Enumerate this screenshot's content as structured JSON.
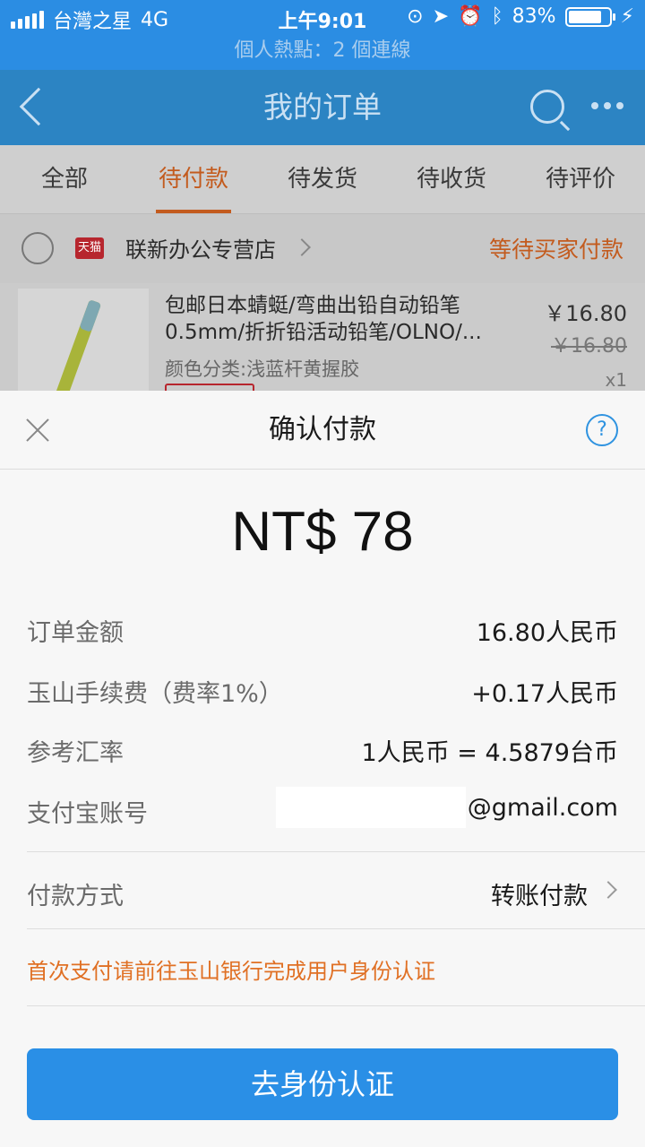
{
  "status_bar": {
    "carrier": "台灣之星",
    "network": "4G",
    "time": "上午9:01",
    "battery": "83%",
    "battery_level": 0.83
  },
  "hotspot_banner": "個人熱點：2 個連線",
  "navbar": {
    "title": "我的订单"
  },
  "tabs": [
    {
      "label": "全部",
      "active": false
    },
    {
      "label": "待付款",
      "active": true
    },
    {
      "label": "待发货",
      "active": false
    },
    {
      "label": "待收货",
      "active": false
    },
    {
      "label": "待评价",
      "active": false
    }
  ],
  "order": {
    "shop_badge": "天猫",
    "shop_name": "联新办公专营店",
    "status": "等待买家付款",
    "product": {
      "title": "包邮日本蜻蜓/弯曲出铅自动铅笔0.5mm/折折铅活动铅笔/OLNO/...",
      "sku": "颜色分类:浅蓝杆黄握胶",
      "price": "￥16.80",
      "original_price": "￥16.80",
      "qty": "x1"
    }
  },
  "payment_sheet": {
    "title": "确认付款",
    "amount": "NT$ 78",
    "rows": [
      {
        "label": "订单金额",
        "value": "16.80人民币"
      },
      {
        "label": "玉山手续费（费率1%）",
        "value": "+0.17人民币"
      },
      {
        "label": "参考汇率",
        "value": "1人民币 = 4.5879台币"
      },
      {
        "label": "支付宝账号",
        "value": "@gmail.com"
      }
    ],
    "payment_method": {
      "label": "付款方式",
      "value": "转账付款"
    },
    "notice": "首次支付请前往玉山银行完成用户身份认证",
    "cta_label": "去身份认证"
  },
  "colors": {
    "brand_blue": "#2b8de3",
    "accent_orange": "#e07024",
    "button_blue": "#2a8fe6"
  }
}
